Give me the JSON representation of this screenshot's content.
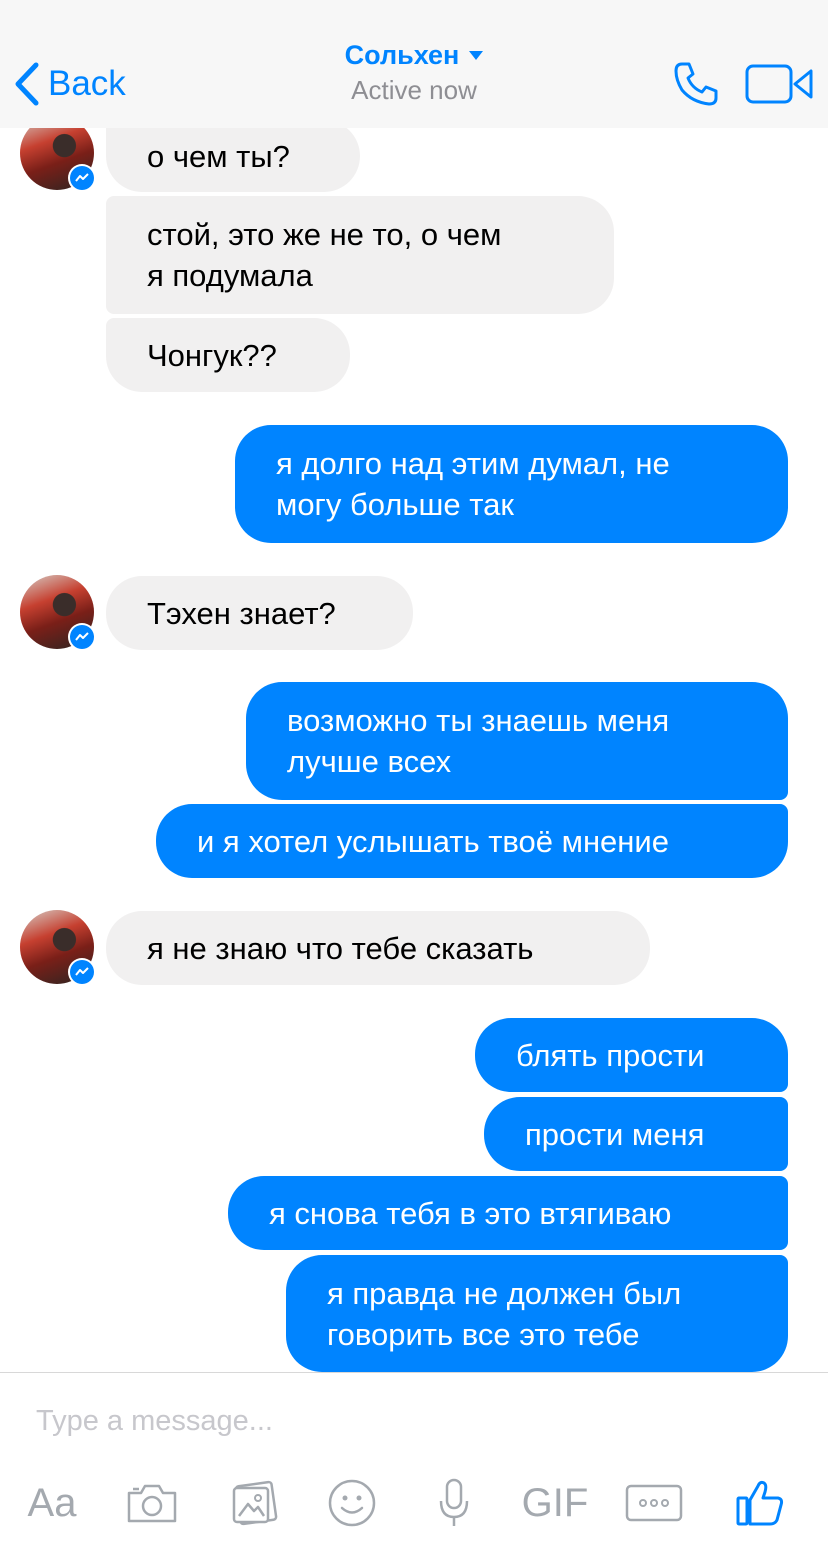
{
  "header": {
    "back_label": "Back",
    "contact_name": "Сольхен",
    "status": "Active now",
    "accent_color": "#0084ff"
  },
  "messages": [
    {
      "id": "m1",
      "side": "in",
      "lines": [
        "о чем ты?"
      ]
    },
    {
      "id": "m2",
      "side": "in",
      "lines": [
        "стой, это же не то, о чем",
        "я подумала"
      ]
    },
    {
      "id": "m3",
      "side": "in",
      "lines": [
        "Чонгук??"
      ]
    },
    {
      "id": "m4",
      "side": "out",
      "lines": [
        "я долго над этим думал, не",
        "могу больше так"
      ]
    },
    {
      "id": "m5",
      "side": "in",
      "lines": [
        "Тэхен знает?"
      ]
    },
    {
      "id": "m6",
      "side": "out",
      "lines": [
        "возможно ты знаешь меня",
        "лучше всех"
      ]
    },
    {
      "id": "m7",
      "side": "out",
      "lines": [
        "и я хотел услышать твоё мнение"
      ]
    },
    {
      "id": "m8",
      "side": "in",
      "lines": [
        "я не знаю что тебе сказать"
      ]
    },
    {
      "id": "m9",
      "side": "out",
      "lines": [
        "блять прости"
      ]
    },
    {
      "id": "m10",
      "side": "out",
      "lines": [
        "прости меня"
      ]
    },
    {
      "id": "m11",
      "side": "out",
      "lines": [
        "я снова тебя в это втягиваю"
      ]
    },
    {
      "id": "m12",
      "side": "out",
      "lines": [
        "я правда не должен был",
        "говорить все это тебе"
      ]
    }
  ],
  "composer": {
    "placeholder": "Type a message...",
    "toolbar": {
      "text_label": "Aa",
      "gif_label": "GIF",
      "icons": [
        "text-format-icon",
        "camera-icon",
        "gallery-icon",
        "emoji-icon",
        "microphone-icon",
        "gif-icon",
        "more-icon",
        "thumbs-up-icon"
      ]
    }
  }
}
